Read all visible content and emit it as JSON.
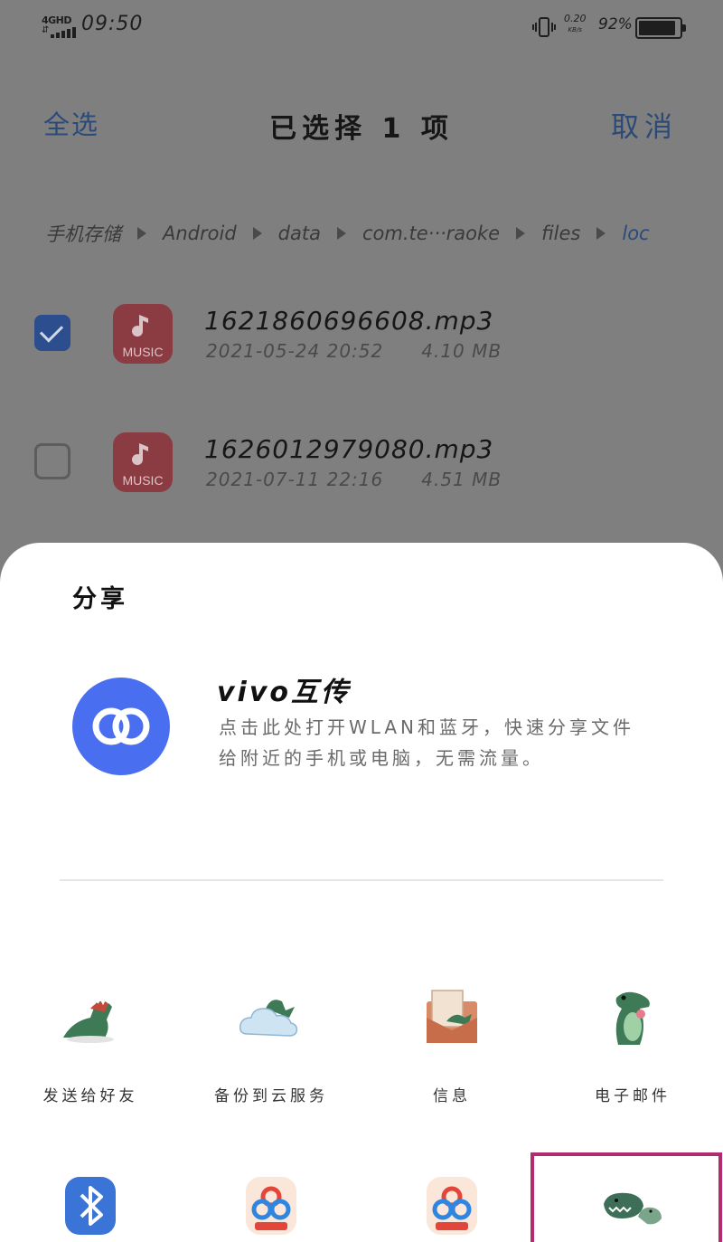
{
  "status_bar": {
    "network": "4GHD",
    "time": "09:50",
    "speed": "0.20",
    "speed_unit": "KB/s",
    "battery": "92%"
  },
  "header": {
    "select_all": "全选",
    "title": "已选择 1 项",
    "cancel": "取消"
  },
  "breadcrumb": [
    "手机存储",
    "Android",
    "data",
    "com.te···raoke",
    "files",
    "loc"
  ],
  "files": [
    {
      "name": "1621860696608.mp3",
      "date": "2021-05-24 20:52",
      "size": "4.10 MB",
      "checked": true,
      "icon_label": "MUSIC"
    },
    {
      "name": "1626012979080.mp3",
      "date": "2021-07-11 22:16",
      "size": "4.51 MB",
      "checked": false,
      "icon_label": "MUSIC"
    }
  ],
  "share": {
    "title": "分享",
    "vivo_title": "vivo互传",
    "vivo_desc": "点击此处打开WLAN和蓝牙，快速分享文件给附近的手机或电脑，无需流量。",
    "apps": [
      {
        "label": "发送给好友",
        "icon": "dino-send-icon"
      },
      {
        "label": "备份到云服务",
        "icon": "dino-cloud-icon"
      },
      {
        "label": "信息",
        "icon": "dino-message-icon"
      },
      {
        "label": "电子邮件",
        "icon": "dino-email-icon"
      },
      {
        "label": "",
        "icon": "bluetooth-icon"
      },
      {
        "label": "",
        "icon": "baidu-cloud-icon"
      },
      {
        "label": "",
        "icon": "baidu-cloud-icon"
      },
      {
        "label": "",
        "icon": "dino-group-icon"
      }
    ]
  },
  "colors": {
    "accent": "#4a6ef0",
    "highlight": "#b22b6e",
    "music_icon": "#d8424f"
  }
}
